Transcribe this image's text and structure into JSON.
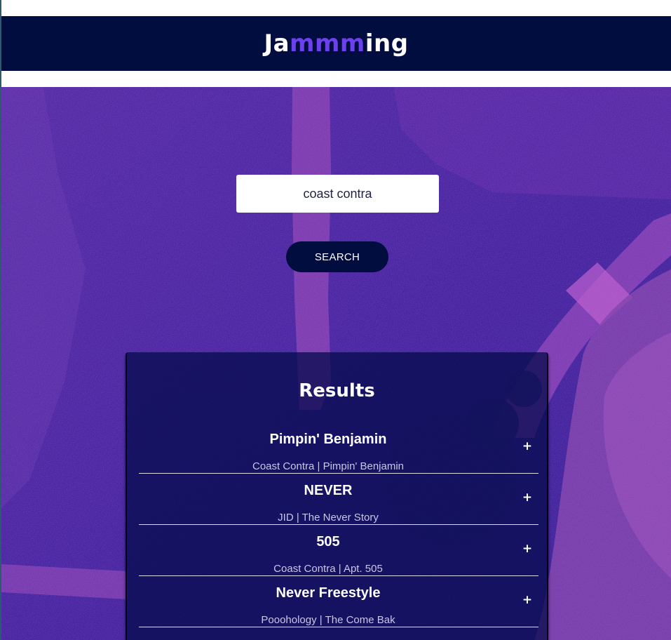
{
  "app": {
    "logo_prefix": "Ja",
    "logo_accent": "mmm",
    "logo_suffix": "ing"
  },
  "colors": {
    "header_bg": "#010c3f",
    "accent": "#6c41ec",
    "hero_dark": "#3a1896",
    "hero_light": "#7a33a8"
  },
  "search": {
    "value": "coast contra",
    "button_label": "SEARCH"
  },
  "results": {
    "title": "Results",
    "add_icon": "+",
    "tracks": [
      {
        "name": "Pimpin' Benjamin",
        "artist": "Coast Contra",
        "album": "Pimpin' Benjamin",
        "meta": "Coast Contra | Pimpin' Benjamin"
      },
      {
        "name": "NEVER",
        "artist": "JID",
        "album": "The Never Story",
        "meta": "JID | The Never Story"
      },
      {
        "name": "505",
        "artist": "Coast Contra",
        "album": "Apt. 505",
        "meta": "Coast Contra | Apt. 505"
      },
      {
        "name": "Never Freestyle",
        "artist": "Pooohology",
        "album": "The Come Bak",
        "meta": "Pooohology | The Come Bak"
      }
    ]
  }
}
